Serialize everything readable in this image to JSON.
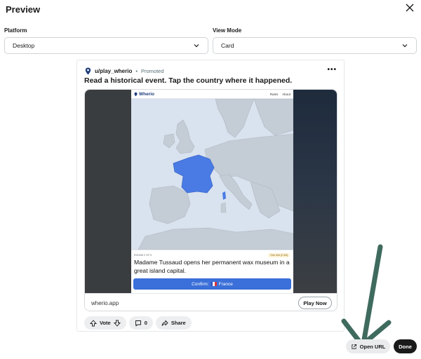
{
  "modal": {
    "title": "Preview"
  },
  "platform": {
    "label": "Platform",
    "value": "Desktop"
  },
  "view_mode": {
    "label": "View Mode",
    "value": "Card"
  },
  "post": {
    "username": "u/play_wherio",
    "separator": "•",
    "promoted": "Promoted",
    "more": "•••",
    "title": "Read a historical event. Tap the country where it happened.",
    "domain": "wherio.app",
    "play_label": "Play Now"
  },
  "game": {
    "logo": "Wherio",
    "rules": "Rules",
    "about": "About",
    "round": "ROUND 2 OF 5",
    "badge": "One hint (2 left)",
    "question": "Madame Tussaud opens her permanent wax museum in a great island capital.",
    "confirm_label": "Confirm:",
    "confirm_country": "France"
  },
  "actions": {
    "vote_label": "Vote",
    "comments_count": "0",
    "share_label": "Share"
  },
  "footer": {
    "open_url_label": "Open URL",
    "done_label": "Done"
  },
  "colors": {
    "highlight": "#4a7be5",
    "accent_button": "#3b6fd9",
    "annotation_arrow": "#3f6b5e"
  },
  "icons": [
    "close-icon",
    "chevron-down-icon",
    "location-pin-icon",
    "upvote-icon",
    "downvote-icon",
    "comment-icon",
    "share-icon",
    "external-link-icon"
  ]
}
